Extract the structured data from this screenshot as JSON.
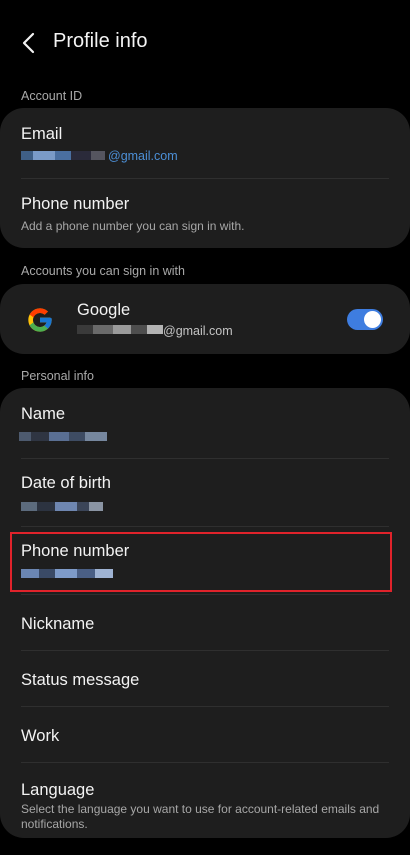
{
  "header": {
    "title": "Profile info"
  },
  "sections": {
    "account_id": "Account ID",
    "accounts_sign_in": "Accounts you can sign in with",
    "personal_info": "Personal info"
  },
  "account": {
    "email_label": "Email",
    "email_value": "@gmail.com",
    "phone_label": "Phone number",
    "phone_sub": "Add a phone number you can sign in with."
  },
  "google": {
    "label": "Google",
    "email": "@gmail.com",
    "toggle_on": true
  },
  "personal": {
    "name_label": "Name",
    "dob_label": "Date of birth",
    "phone_label": "Phone number",
    "nickname_label": "Nickname",
    "status_label": "Status message",
    "work_label": "Work",
    "language_label": "Language",
    "language_sub": "Select the language you want to use for account-related emails and notifications."
  },
  "colors": {
    "accent": "#3e7de0",
    "link": "#4c8fd6",
    "highlight": "#e0232b",
    "card": "#1e1e1e"
  },
  "icons": {
    "back": "chevron-left-icon",
    "google": "google-logo-icon"
  }
}
